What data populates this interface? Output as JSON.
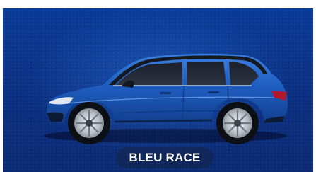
{
  "color_option": {
    "name": "BLEU RACE",
    "paint_hex": "#1f5fc2"
  },
  "background": {
    "accent": "#0b2f80"
  }
}
